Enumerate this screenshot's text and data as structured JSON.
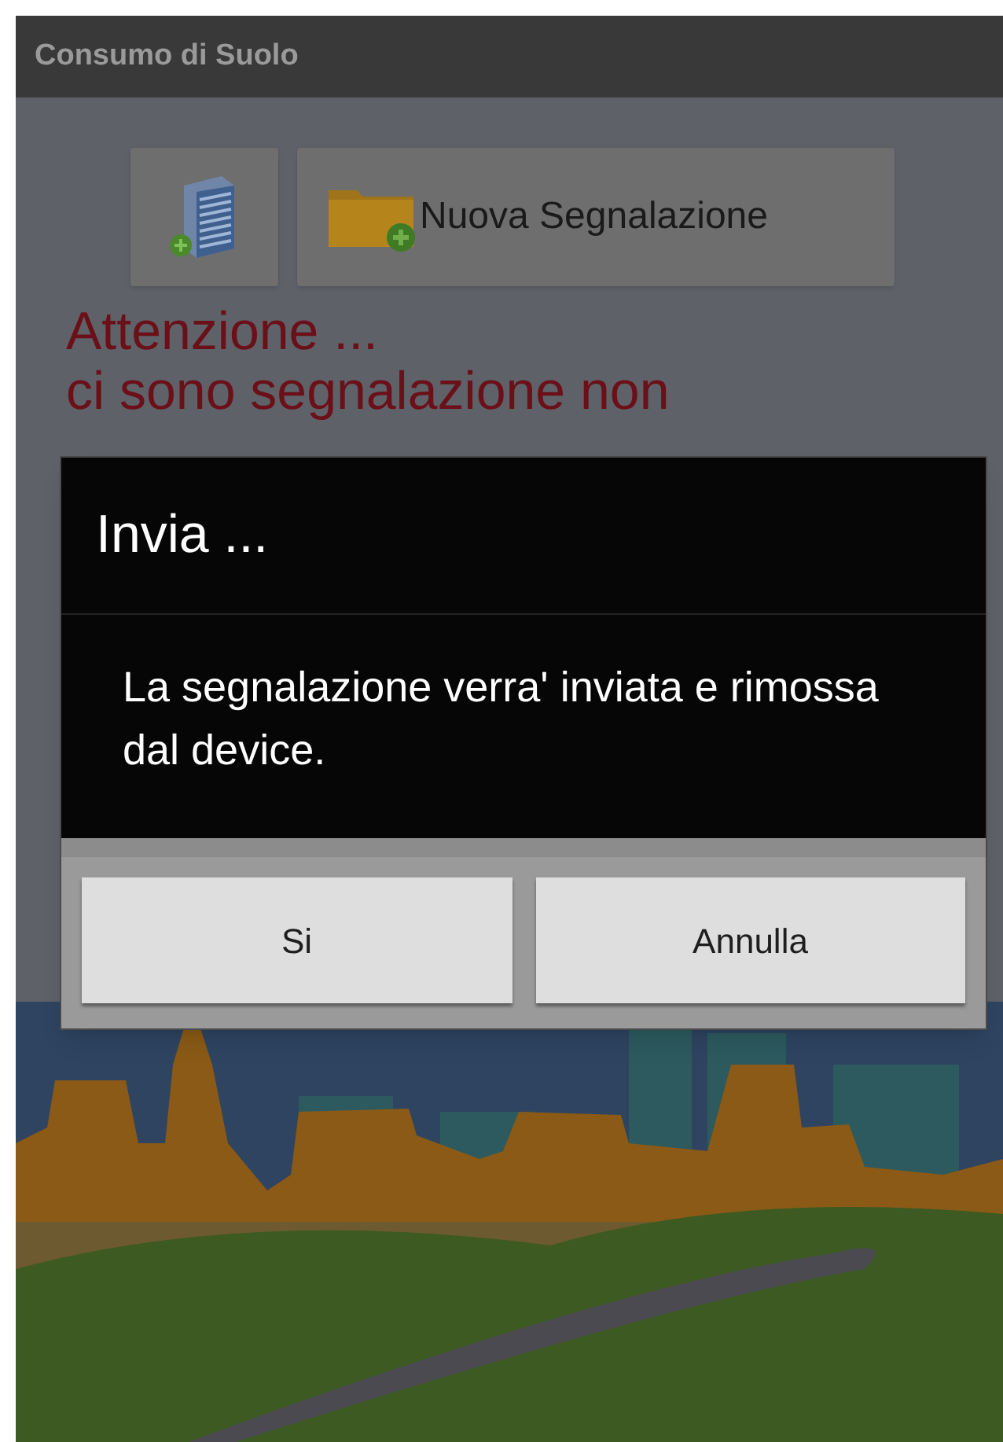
{
  "app_bar": {
    "title": "Consumo di Suolo"
  },
  "toolbar": [
    {
      "kind": "building"
    },
    {
      "kind": "folder",
      "label": "Nuova Segnalazione"
    }
  ],
  "warning": [
    "Attenzione ...",
    "ci sono segnalazione non"
  ],
  "dialog": {
    "title": "Invia ...",
    "message": "La segnalazione verra' inviata e rimossa dal device.",
    "buttons": [
      "Si",
      "Annulla"
    ]
  }
}
